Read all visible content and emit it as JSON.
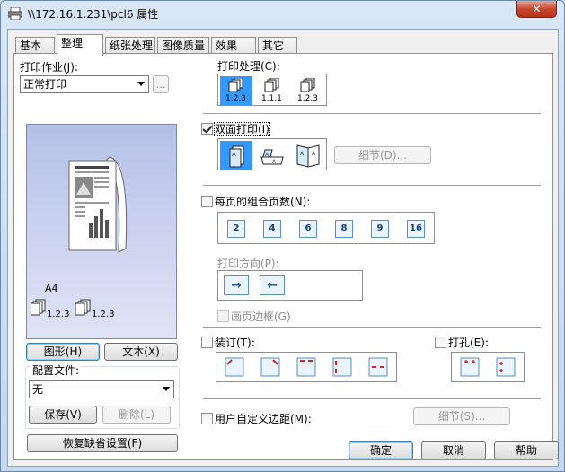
{
  "window": {
    "title": "\\\\172.16.1.231\\pcl6 属性",
    "close_label": "✕"
  },
  "tabs": [
    {
      "label": "基本",
      "active": false
    },
    {
      "label": "整理",
      "active": true
    },
    {
      "label": "纸张处理",
      "active": false
    },
    {
      "label": "图像质量",
      "active": false
    },
    {
      "label": "效果",
      "active": false
    },
    {
      "label": "其它",
      "active": false
    }
  ],
  "left": {
    "print_job_label": "打印作业(J):",
    "print_job_value": "正常打印",
    "more_button": "...",
    "paper_size": "A4",
    "sample_order_label": "1.2.3",
    "graphic_button": "图形(H)",
    "text_button": "文本(X)",
    "config_label": "配置文件:",
    "config_value": "无",
    "save_button": "保存(V)",
    "delete_button": "删除(L)",
    "restore_button": "恢复缺省设置(F)"
  },
  "print_processing": {
    "label": "打印处理(C):",
    "options": [
      "1.2.3",
      "1.1.1",
      "1.2.3"
    ]
  },
  "duplex": {
    "label": "双面打印(I)",
    "checked": true,
    "details_button": "细节(D)..."
  },
  "nup": {
    "label": "每页的组合页数(N):",
    "checked": false,
    "options": [
      "2",
      "4",
      "6",
      "8",
      "9",
      "16"
    ]
  },
  "orientation": {
    "label": "打印方向(P):",
    "arrows": [
      "→",
      "←"
    ]
  },
  "page_border": {
    "label": "画页边框(G)",
    "checked": false
  },
  "staple": {
    "label": "装订(T):",
    "checked": false
  },
  "punch": {
    "label": "打孔(E):",
    "checked": false
  },
  "custom_margin": {
    "label": "用户自定义边距(M):",
    "checked": false,
    "details_button": "细节(S)..."
  },
  "footer": {
    "ok": "确定",
    "cancel": "取消",
    "help": "帮助"
  },
  "colors": {
    "selected": "#3399ff",
    "title_bar": "#cbdcf0",
    "close": "#c7452a"
  }
}
